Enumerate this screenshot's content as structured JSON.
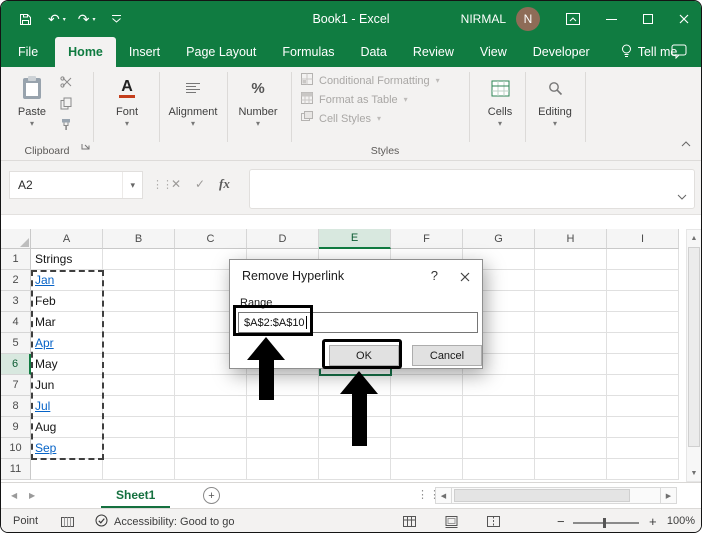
{
  "window": {
    "title": "Book1 - Excel",
    "user_name": "NIRMAL",
    "avatar_initial": "N"
  },
  "ribbon_tabs": {
    "file": "File",
    "tabs": [
      "Home",
      "Insert",
      "Page Layout",
      "Formulas",
      "Data",
      "Review",
      "View",
      "Developer"
    ],
    "selected": "Home",
    "tell_me": "Tell me"
  },
  "ribbon": {
    "paste_label": "Paste",
    "clipboard_group_label": "Clipboard",
    "font_group_label": "Font",
    "font_icon_letter": "A",
    "alignment_group_label": "Alignment",
    "number_group_label": "Number",
    "styles": {
      "conditional_formatting": "Conditional Formatting",
      "format_as_table": "Format as Table",
      "cell_styles": "Cell Styles",
      "group_label": "Styles"
    },
    "cells_group_label": "Cells",
    "editing_group_label": "Editing"
  },
  "formula_bar": {
    "name_box_value": "A2",
    "fx_label": "fx",
    "formula_value": ""
  },
  "grid": {
    "columns": [
      "A",
      "B",
      "C",
      "D",
      "E",
      "F",
      "G",
      "H",
      "I"
    ],
    "rows": [
      "1",
      "2",
      "3",
      "4",
      "5",
      "6",
      "7",
      "8",
      "9",
      "10",
      "11"
    ],
    "active_column": "E",
    "active_row": "6",
    "col_a_values": [
      {
        "row": "1",
        "text": "Strings",
        "hyperlink": false
      },
      {
        "row": "2",
        "text": "Jan",
        "hyperlink": true
      },
      {
        "row": "3",
        "text": "Feb",
        "hyperlink": false
      },
      {
        "row": "4",
        "text": "Mar",
        "hyperlink": false
      },
      {
        "row": "5",
        "text": "Apr",
        "hyperlink": true
      },
      {
        "row": "6",
        "text": "May",
        "hyperlink": false
      },
      {
        "row": "7",
        "text": "Jun",
        "hyperlink": false
      },
      {
        "row": "8",
        "text": "Jul",
        "hyperlink": true
      },
      {
        "row": "9",
        "text": "Aug",
        "hyperlink": false
      },
      {
        "row": "10",
        "text": "Sep",
        "hyperlink": true
      }
    ]
  },
  "dialog": {
    "title": "Remove Hyperlink",
    "help_button": "?",
    "range_label": "Range",
    "range_value": "$A$2:$A$10",
    "ok_button": "OK",
    "cancel_button": "Cancel"
  },
  "sheet_tabs": {
    "active_sheet": "Sheet1",
    "add_sheet": "+"
  },
  "status_bar": {
    "mode": "Point",
    "accessibility": "Accessibility: Good to go",
    "zoom_out": "−",
    "zoom_in": "+",
    "zoom_level": "100%"
  },
  "glyphs": {
    "dropdown": "▾",
    "undo": "↶",
    "redo": "↷",
    "cancel_x": "✕",
    "check": "✓",
    "up": "▲",
    "down": "▼",
    "left": "◀",
    "right": "▶",
    "dots": "⋮⋮",
    "percent": "%"
  },
  "colors": {
    "accent_green": "#107c41",
    "hyperlink_blue": "#0563c1",
    "annotation": "#000000"
  }
}
